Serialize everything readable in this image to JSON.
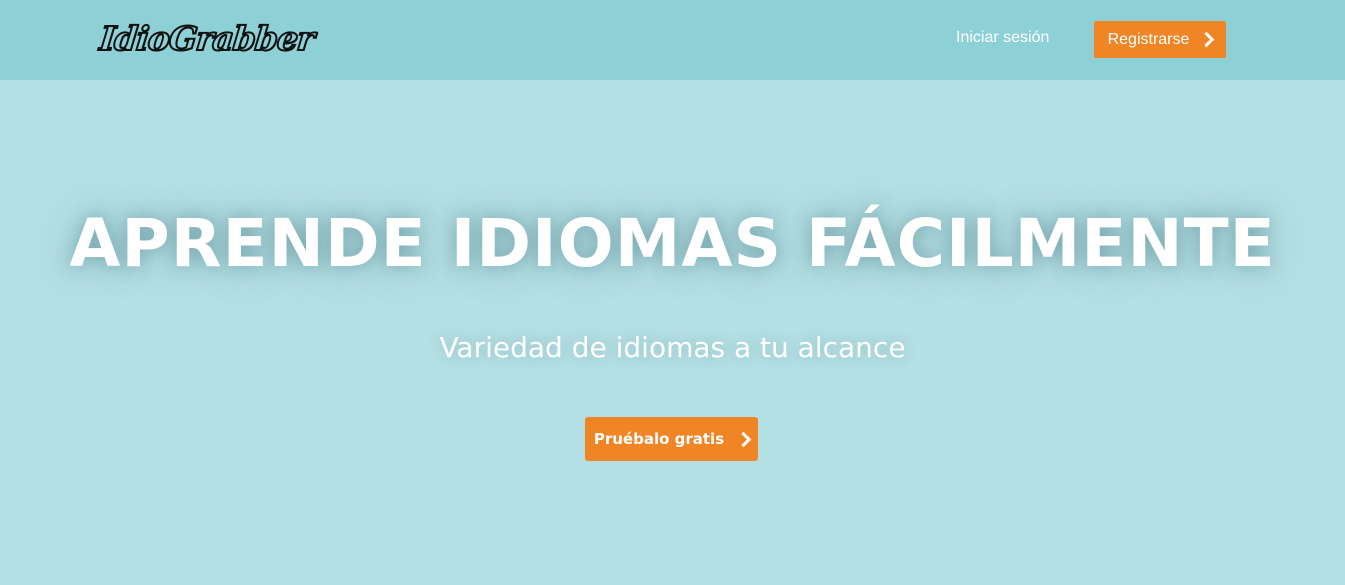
{
  "header": {
    "logo_text": "IdioGrabber",
    "login_label": "Iniciar sesión",
    "register_label": "Registrarse"
  },
  "hero": {
    "title": "APRENDE IDIOMAS FÁCILMENTE",
    "subtitle": "Variedad de idiomas a tu alcance",
    "cta_label": "Pruébalo gratis"
  },
  "colors": {
    "header_bg": "#8dd1d7",
    "hero_bg": "#b4dfe4",
    "accent": "#f08526",
    "text": "#ffffff"
  },
  "icons": {
    "register_icon": "chevron-right-icon",
    "cta_icon": "chevron-right-icon"
  }
}
